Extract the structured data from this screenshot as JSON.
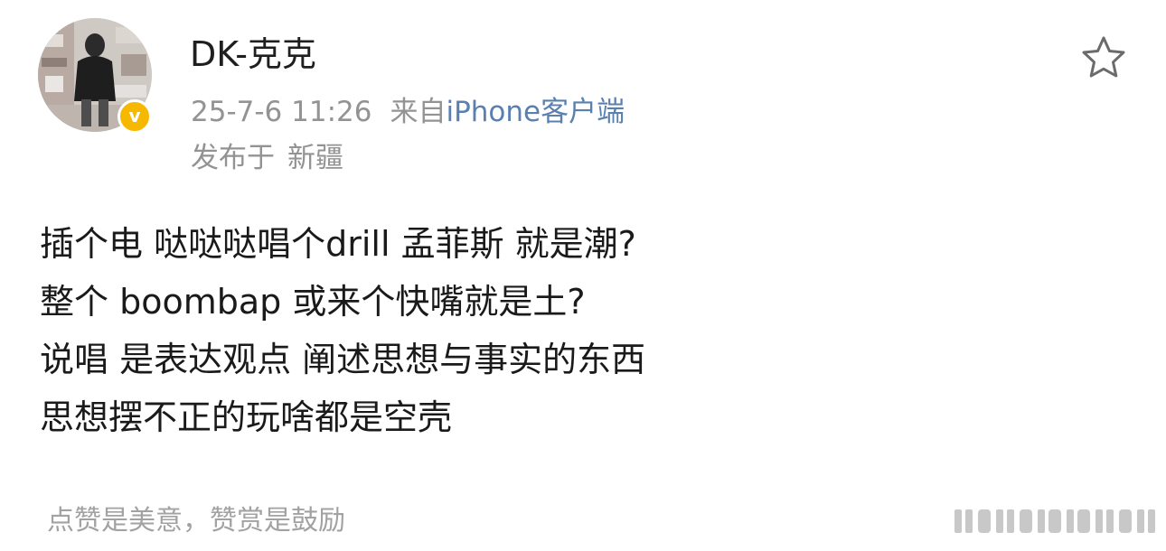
{
  "author": {
    "name": "DK-克克",
    "avatar_icon": "user-avatar",
    "verified_icon": "verified-badge-icon",
    "verified_mark": "v",
    "verified_color": "#f6b800"
  },
  "meta": {
    "timestamp": "25-7-6 11:26",
    "source_prefix": "来自",
    "source_name": "iPhone客户端",
    "location_prefix": "发布于",
    "location": "新疆"
  },
  "actions": {
    "favorite_icon": "star-outline-icon"
  },
  "post": {
    "lines": [
      "插个电 哒哒哒唱个drill 孟菲斯 就是潮?",
      "整个 boombap 或来个快嘴就是土?",
      "说唱 是表达观点 阐述思想与事实的东西",
      "思想摆不正的玩啥都是空壳"
    ]
  },
  "footer": {
    "reward_text": "点赞是美意，赞赏是鼓励"
  },
  "colors": {
    "text_primary": "#1a1a1a",
    "text_secondary": "#939393",
    "link": "#5a80b0",
    "footer": "#a2a2a2"
  }
}
